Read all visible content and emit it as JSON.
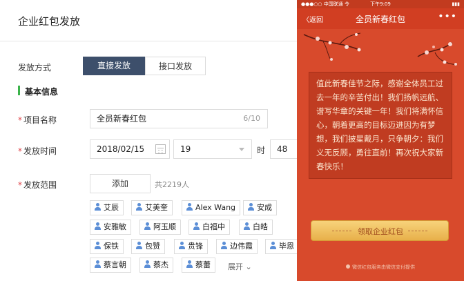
{
  "admin": {
    "title": "企业红包发放",
    "send_method": {
      "label": "发放方式",
      "options": [
        "直接发放",
        "接口发放"
      ],
      "selected": "直接发放"
    },
    "section_title": "基本信息",
    "project_name": {
      "label": "项目名称",
      "value": "全员新春红包",
      "counter": "6/10"
    },
    "send_time": {
      "label": "发放时间",
      "date": "2018/02/15",
      "hour": "19",
      "hour_unit": "时",
      "minute": "48"
    },
    "scope": {
      "label": "发放范围",
      "add_label": "添加",
      "count_text": "共2219人",
      "tags": [
        "艾辰",
        "艾美奎",
        "Alex Wang",
        "安成",
        "安雅敏",
        "阿玉顺",
        "白福中",
        "白皓",
        "保铁",
        "包赞",
        "贵锋",
        "边伟霞",
        "毕恩",
        "蔡言朝",
        "蔡杰",
        "蔡蕾"
      ],
      "expand_label": "展开"
    }
  },
  "phone": {
    "status": {
      "left": "●●●○○ 中国联通 令",
      "time": "下午9:09",
      "right": "▮▮▮"
    },
    "back_label": "返回",
    "title": "全员新春红包",
    "more_label": "•••",
    "message": "值此新春佳节之际，感谢全体员工过去一年的辛苦付出！我们扬帆远航、谱写华章的关键一年！我们将满怀信心，朝着更高的目标迈进因为有梦想，我们披星戴月，只争朝夕：我们义无反顾，勇往直前！再次祝大家新春快乐！",
    "claim_label": "领取企业红包",
    "footer": "微信红包服务由微信支付提供"
  },
  "colors": {
    "primary_button": "#3d4f6b",
    "section_accent": "#3bb34a",
    "required_star": "#e0454a",
    "phone_bg": "#d84a2c",
    "claim_gold": "#f2c466"
  }
}
